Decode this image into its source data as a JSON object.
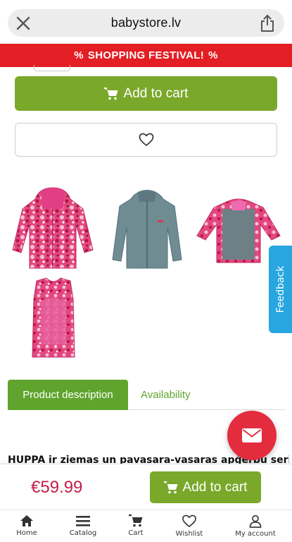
{
  "browser": {
    "url": "babystore.lv"
  },
  "promo": {
    "text": "SHOPPING FESTIVAL!",
    "symbol": "%"
  },
  "product": {
    "add_to_cart_label": "Add to cart",
    "price": "€59.99",
    "gallery": [
      "pink-floral-jacket",
      "grey-fleece-jacket",
      "jacket-open-liner",
      "pink-floral-vest"
    ]
  },
  "feedback": {
    "label": "Feedback"
  },
  "tabs": [
    {
      "label": "Product description",
      "active": true
    },
    {
      "label": "Availability",
      "active": false
    }
  ],
  "description": {
    "text": "HUPPA ir ziemas un pavasara-vasaras apģērbu serija"
  },
  "sticky": {
    "price": "€59.99",
    "add_to_cart_label": "Add to cart"
  },
  "nav": [
    {
      "label": "Home",
      "icon": "home-icon"
    },
    {
      "label": "Catalog",
      "icon": "menu-icon"
    },
    {
      "label": "Cart",
      "icon": "cart-icon"
    },
    {
      "label": "Wishlist",
      "icon": "heart-icon"
    },
    {
      "label": "My account",
      "icon": "user-icon"
    }
  ],
  "colors": {
    "accent_green": "#7aa82a",
    "promo_red": "#e31e24",
    "price_red": "#c31c4a",
    "feedback_blue": "#27a6e0",
    "fab_red": "#e42c3f"
  }
}
